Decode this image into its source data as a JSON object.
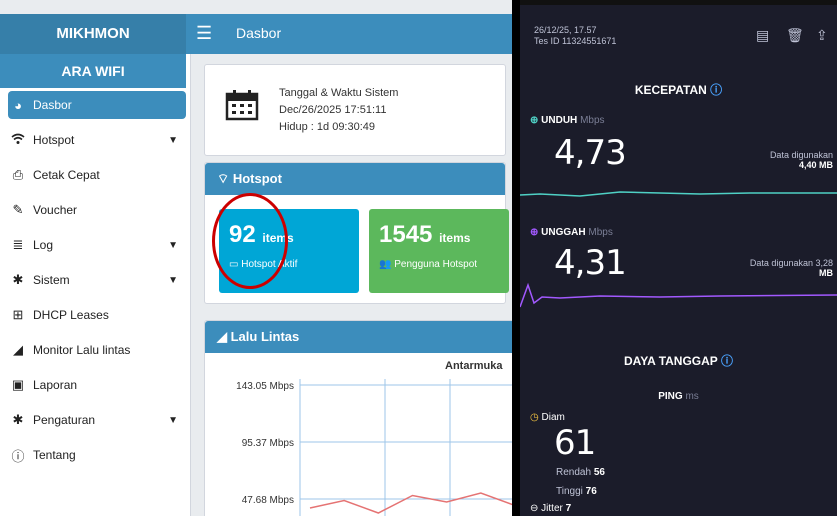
{
  "left_app": {
    "brand": "MIKHMON",
    "topbar_title": "Dasbor",
    "ssid_label": "ARA WIFI",
    "menu": [
      {
        "label": "Dasbor",
        "icon": "dashboard-icon"
      },
      {
        "label": "Hotspot",
        "icon": "wifi-icon"
      },
      {
        "label": "Cetak Cepat",
        "icon": "printer-icon"
      },
      {
        "label": "Voucher",
        "icon": "ticket-icon"
      },
      {
        "label": "Log",
        "icon": "list-icon"
      },
      {
        "label": "Sistem",
        "icon": "gear-icon"
      },
      {
        "label": "DHCP Leases",
        "icon": "network-icon"
      },
      {
        "label": "Monitor Lalu lintas",
        "icon": "area-chart-icon"
      },
      {
        "label": "Laporan",
        "icon": "money-icon"
      },
      {
        "label": "Pengaturan",
        "icon": "gear-icon"
      },
      {
        "label": "Tentang",
        "icon": "info-icon"
      }
    ],
    "system_time": {
      "title": "Tanggal & Waktu Sistem",
      "datetime": "Dec/26/2025 17:51:11",
      "uptime": "Hidup : 1d 09:30:49"
    },
    "hotspot": {
      "header": "Hotspot",
      "active_count": "92",
      "active_unit": "items",
      "active_label": "Hotspot Aktif",
      "users_count": "1545",
      "users_unit": "items",
      "users_label": "Pengguna Hotspot"
    },
    "traffic": {
      "header": "Lalu Lintas",
      "chart_title": "Antarmuka"
    }
  },
  "chart_data": {
    "type": "line",
    "title": "Antarmuka",
    "yticks": [
      "143.05 Mbps",
      "95.37 Mbps",
      "47.68 Mbps"
    ],
    "ytick_values": [
      143.05,
      95.37,
      47.68
    ],
    "series": [
      {
        "values": [
          30,
          45,
          20,
          55,
          42,
          60,
          35
        ]
      }
    ],
    "grid": true
  },
  "speedtest": {
    "date": "26/12/25, 17.57",
    "test_id": "Tes ID 11324551671",
    "speed_heading": "KECEPATAN",
    "download_label": "UNDUH",
    "download_unit": "Mbps",
    "download_value": "4,73",
    "download_data_label": "Data digunakan",
    "download_data_value": "4,40 MB",
    "upload_label": "UNGGAH",
    "upload_unit": "Mbps",
    "upload_value": "4,31",
    "upload_data_label": "Data digunakan 3,28",
    "upload_data_value": "MB",
    "response_heading": "DAYA TANGGAP",
    "ping_label": "PING",
    "ping_unit": "ms",
    "idle_label": "Diam",
    "idle_value": "61",
    "low_label": "Rendah",
    "low_value": "56",
    "high_label": "Tinggi",
    "high_value": "76",
    "jitter_label": "Jitter",
    "jitter_value": "7",
    "colors": {
      "download": "#4fd1c5",
      "upload": "#a259ff",
      "background": "#1b1c2a"
    }
  }
}
